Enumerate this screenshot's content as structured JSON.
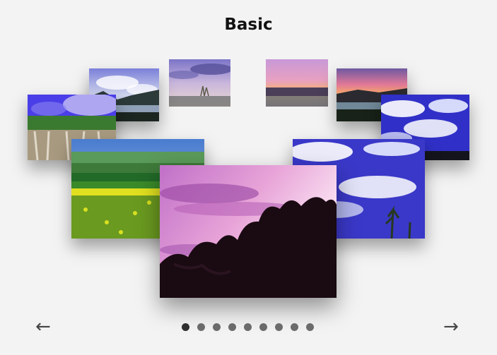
{
  "header": {
    "title": "Basic"
  },
  "controls": {
    "prev_label": "←",
    "next_label": "→"
  },
  "pagination": {
    "count": 9,
    "active_index": 0
  },
  "colors": {
    "background": "#f3f3f3",
    "dot": "#6b6b6b",
    "dot_active": "#2e2e2e"
  }
}
